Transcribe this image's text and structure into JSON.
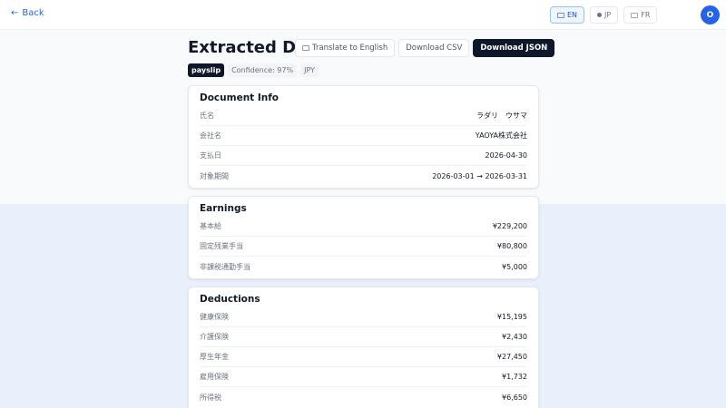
{
  "nav": {
    "back_label": "Back"
  },
  "languages": [
    {
      "code": "EN",
      "active": true
    },
    {
      "code": "JP",
      "active": false
    },
    {
      "code": "FR",
      "active": false
    }
  ],
  "user": {
    "initial": "O"
  },
  "page": {
    "title": "Extracted Data"
  },
  "actions": {
    "translate_label": "Translate to English",
    "csv_label": "Download CSV",
    "json_label": "Download JSON"
  },
  "tags": {
    "doc_type": "payslip",
    "confidence": "Confidence: 97%",
    "currency": "JPY"
  },
  "document_info": {
    "title": "Document Info",
    "rows": [
      {
        "key": "氏名",
        "value": "ラダリ　ウサマ"
      },
      {
        "key": "会社名",
        "value": "YAOYA株式会社"
      },
      {
        "key": "支払日",
        "value": "2026-04-30"
      },
      {
        "key": "対象期間",
        "value": "2026-03-01 → 2026-03-31"
      }
    ]
  },
  "earnings": {
    "title": "Earnings",
    "rows": [
      {
        "key": "基本給",
        "value": "¥229,200"
      },
      {
        "key": "固定残業手当",
        "value": "¥80,800"
      },
      {
        "key": "非課税通勤手当",
        "value": "¥5,000"
      }
    ]
  },
  "deductions": {
    "title": "Deductions",
    "rows": [
      {
        "key": "健康保険",
        "value": "¥15,195"
      },
      {
        "key": "介護保険",
        "value": "¥2,430"
      },
      {
        "key": "厚生年金",
        "value": "¥27,450"
      },
      {
        "key": "雇用保険",
        "value": "¥1,732"
      },
      {
        "key": "所得税",
        "value": "¥6,650"
      }
    ]
  }
}
